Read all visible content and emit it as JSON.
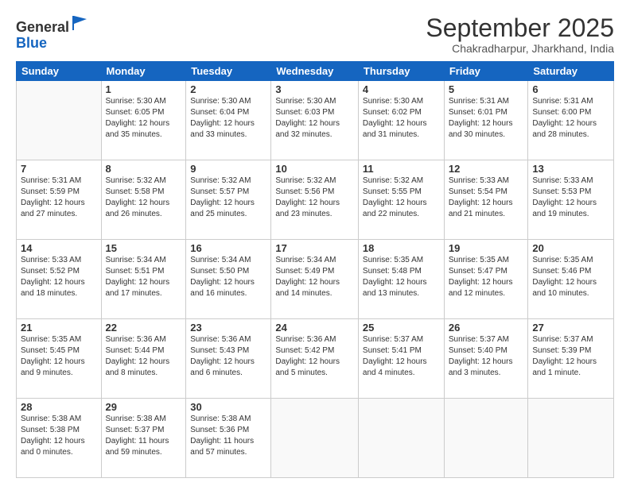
{
  "logo": {
    "general": "General",
    "blue": "Blue"
  },
  "header": {
    "month": "September 2025",
    "location": "Chakradharpur, Jharkhand, India"
  },
  "weekdays": [
    "Sunday",
    "Monday",
    "Tuesday",
    "Wednesday",
    "Thursday",
    "Friday",
    "Saturday"
  ],
  "weeks": [
    [
      {
        "day": "",
        "text": ""
      },
      {
        "day": "1",
        "text": "Sunrise: 5:30 AM\nSunset: 6:05 PM\nDaylight: 12 hours\nand 35 minutes."
      },
      {
        "day": "2",
        "text": "Sunrise: 5:30 AM\nSunset: 6:04 PM\nDaylight: 12 hours\nand 33 minutes."
      },
      {
        "day": "3",
        "text": "Sunrise: 5:30 AM\nSunset: 6:03 PM\nDaylight: 12 hours\nand 32 minutes."
      },
      {
        "day": "4",
        "text": "Sunrise: 5:30 AM\nSunset: 6:02 PM\nDaylight: 12 hours\nand 31 minutes."
      },
      {
        "day": "5",
        "text": "Sunrise: 5:31 AM\nSunset: 6:01 PM\nDaylight: 12 hours\nand 30 minutes."
      },
      {
        "day": "6",
        "text": "Sunrise: 5:31 AM\nSunset: 6:00 PM\nDaylight: 12 hours\nand 28 minutes."
      }
    ],
    [
      {
        "day": "7",
        "text": "Sunrise: 5:31 AM\nSunset: 5:59 PM\nDaylight: 12 hours\nand 27 minutes."
      },
      {
        "day": "8",
        "text": "Sunrise: 5:32 AM\nSunset: 5:58 PM\nDaylight: 12 hours\nand 26 minutes."
      },
      {
        "day": "9",
        "text": "Sunrise: 5:32 AM\nSunset: 5:57 PM\nDaylight: 12 hours\nand 25 minutes."
      },
      {
        "day": "10",
        "text": "Sunrise: 5:32 AM\nSunset: 5:56 PM\nDaylight: 12 hours\nand 23 minutes."
      },
      {
        "day": "11",
        "text": "Sunrise: 5:32 AM\nSunset: 5:55 PM\nDaylight: 12 hours\nand 22 minutes."
      },
      {
        "day": "12",
        "text": "Sunrise: 5:33 AM\nSunset: 5:54 PM\nDaylight: 12 hours\nand 21 minutes."
      },
      {
        "day": "13",
        "text": "Sunrise: 5:33 AM\nSunset: 5:53 PM\nDaylight: 12 hours\nand 19 minutes."
      }
    ],
    [
      {
        "day": "14",
        "text": "Sunrise: 5:33 AM\nSunset: 5:52 PM\nDaylight: 12 hours\nand 18 minutes."
      },
      {
        "day": "15",
        "text": "Sunrise: 5:34 AM\nSunset: 5:51 PM\nDaylight: 12 hours\nand 17 minutes."
      },
      {
        "day": "16",
        "text": "Sunrise: 5:34 AM\nSunset: 5:50 PM\nDaylight: 12 hours\nand 16 minutes."
      },
      {
        "day": "17",
        "text": "Sunrise: 5:34 AM\nSunset: 5:49 PM\nDaylight: 12 hours\nand 14 minutes."
      },
      {
        "day": "18",
        "text": "Sunrise: 5:35 AM\nSunset: 5:48 PM\nDaylight: 12 hours\nand 13 minutes."
      },
      {
        "day": "19",
        "text": "Sunrise: 5:35 AM\nSunset: 5:47 PM\nDaylight: 12 hours\nand 12 minutes."
      },
      {
        "day": "20",
        "text": "Sunrise: 5:35 AM\nSunset: 5:46 PM\nDaylight: 12 hours\nand 10 minutes."
      }
    ],
    [
      {
        "day": "21",
        "text": "Sunrise: 5:35 AM\nSunset: 5:45 PM\nDaylight: 12 hours\nand 9 minutes."
      },
      {
        "day": "22",
        "text": "Sunrise: 5:36 AM\nSunset: 5:44 PM\nDaylight: 12 hours\nand 8 minutes."
      },
      {
        "day": "23",
        "text": "Sunrise: 5:36 AM\nSunset: 5:43 PM\nDaylight: 12 hours\nand 6 minutes."
      },
      {
        "day": "24",
        "text": "Sunrise: 5:36 AM\nSunset: 5:42 PM\nDaylight: 12 hours\nand 5 minutes."
      },
      {
        "day": "25",
        "text": "Sunrise: 5:37 AM\nSunset: 5:41 PM\nDaylight: 12 hours\nand 4 minutes."
      },
      {
        "day": "26",
        "text": "Sunrise: 5:37 AM\nSunset: 5:40 PM\nDaylight: 12 hours\nand 3 minutes."
      },
      {
        "day": "27",
        "text": "Sunrise: 5:37 AM\nSunset: 5:39 PM\nDaylight: 12 hours\nand 1 minute."
      }
    ],
    [
      {
        "day": "28",
        "text": "Sunrise: 5:38 AM\nSunset: 5:38 PM\nDaylight: 12 hours\nand 0 minutes."
      },
      {
        "day": "29",
        "text": "Sunrise: 5:38 AM\nSunset: 5:37 PM\nDaylight: 11 hours\nand 59 minutes."
      },
      {
        "day": "30",
        "text": "Sunrise: 5:38 AM\nSunset: 5:36 PM\nDaylight: 11 hours\nand 57 minutes."
      },
      {
        "day": "",
        "text": ""
      },
      {
        "day": "",
        "text": ""
      },
      {
        "day": "",
        "text": ""
      },
      {
        "day": "",
        "text": ""
      }
    ]
  ]
}
